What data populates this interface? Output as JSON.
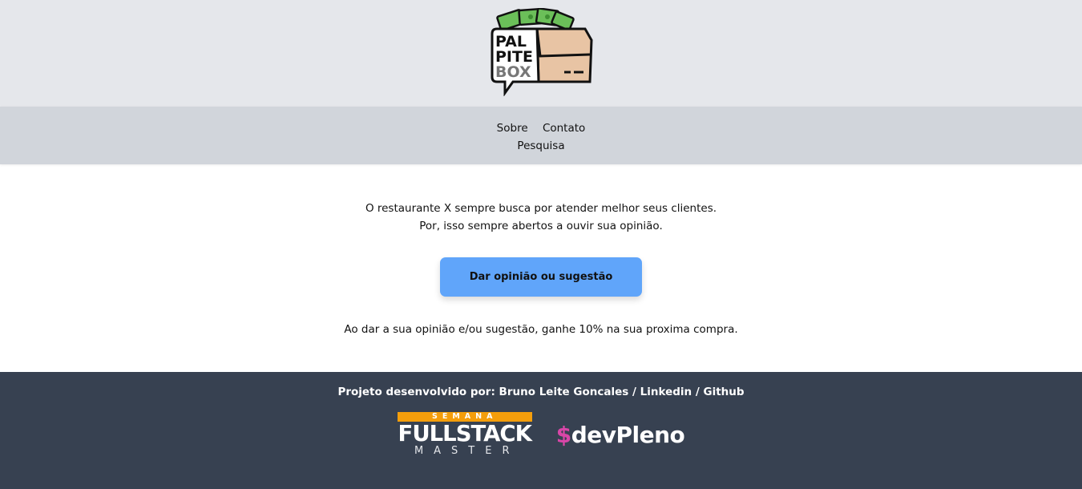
{
  "header": {
    "logo": {
      "line1": "PAL",
      "line2": "PITE",
      "line3": "BOX"
    }
  },
  "nav": {
    "items": [
      {
        "label": "Sobre"
      },
      {
        "label": "Contato"
      },
      {
        "label": "Pesquisa"
      }
    ]
  },
  "main": {
    "intro_line1": "O restaurante X sempre busca por atender melhor seus clientes.",
    "intro_line2": "Por, isso sempre abertos a ouvir sua opinião.",
    "cta_label": "Dar opinião ou sugestão",
    "offer_text": "Ao dar a sua opinião e/ou sugestão, ganhe 10% na sua proxima compra."
  },
  "footer": {
    "credit_prefix": "Projeto desenvolvido por: Bruno Leite Goncales / ",
    "linkedin_label": "Linkedin",
    "separator": " / ",
    "github_label": "Github",
    "partners": {
      "fullstack": {
        "top": "SEMANA",
        "middle": "FULLSTACK",
        "bottom": "MASTER"
      },
      "devpleno": {
        "symbol": "$",
        "name": "devPleno"
      }
    }
  },
  "colors": {
    "header_bg": "#e5e7eb",
    "nav_bg": "#d1d5db",
    "cta_bg": "#60a5fa",
    "footer_bg": "#374151",
    "fullstack_accent": "#f59e0b",
    "devpleno_accent": "#d946a8"
  }
}
